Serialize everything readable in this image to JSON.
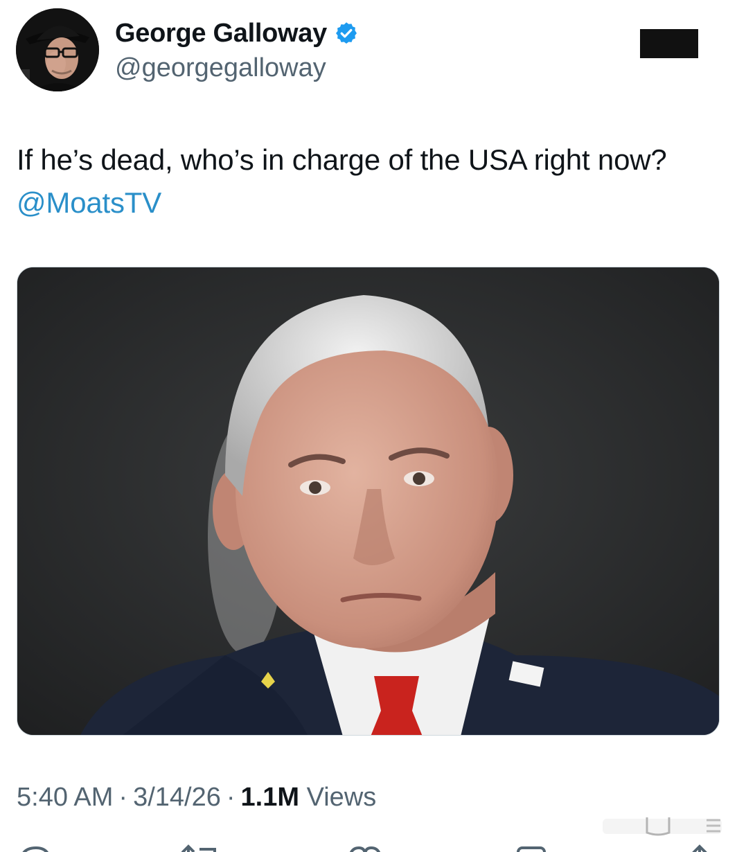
{
  "author": {
    "display_name": "George Galloway",
    "handle": "@georgegalloway",
    "verified": true,
    "verified_color": "#1d9bf0"
  },
  "tweet": {
    "text": "If he’s dead, who’s in charge of the USA right now? ",
    "mention": "@MoatsTV",
    "mention_color": "#2a8fc9"
  },
  "meta": {
    "time": "5:40 AM",
    "date": "3/14/26",
    "views_count": "1.1M",
    "views_label": "Views"
  },
  "icons": {
    "verified": "verified-badge-icon",
    "reply": "reply-icon",
    "repost": "repost-icon",
    "like": "heart-icon",
    "bookmark": "bookmark-icon",
    "share": "share-icon"
  }
}
